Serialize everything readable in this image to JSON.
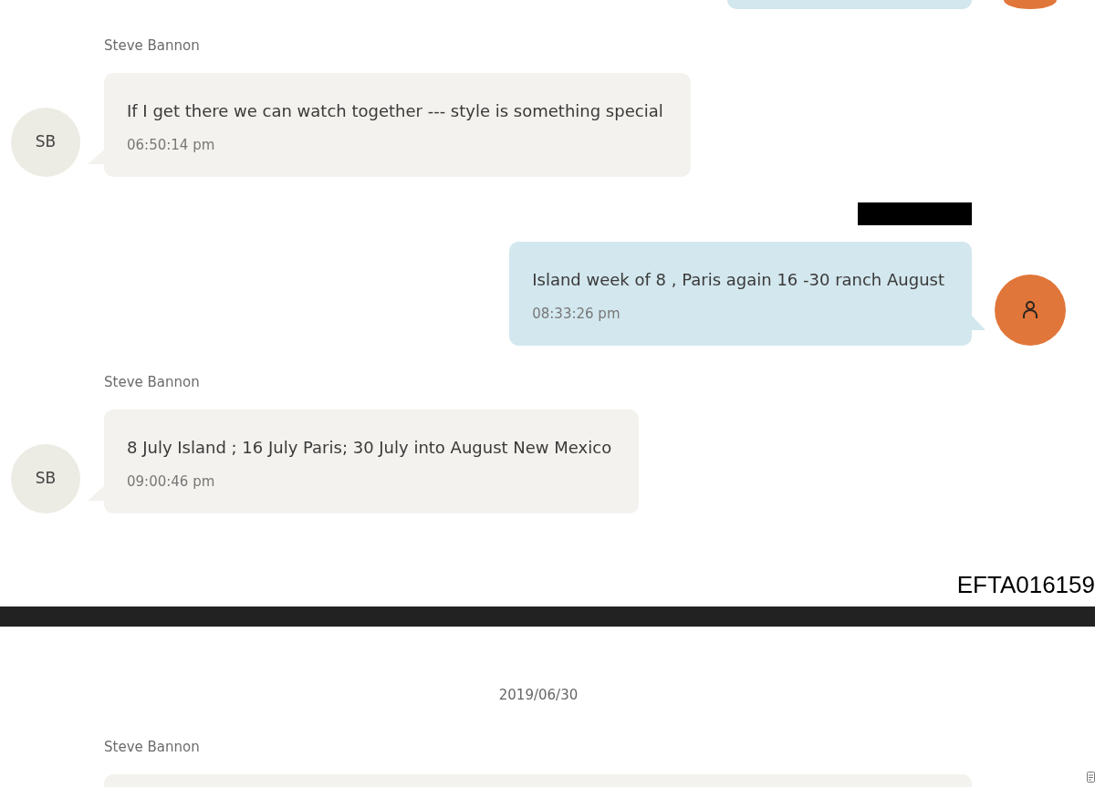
{
  "page_1": {
    "messages": [
      {
        "kind": "outgoing"
      },
      {
        "kind": "incoming",
        "sender": "Steve Bannon",
        "initials": "SB",
        "text": "If I get there we can watch together --- style is something special",
        "time": "06:50:14 pm"
      },
      {
        "kind": "outgoing",
        "sender_redacted": true,
        "text": "Island week of 8 , Paris again 16 -30 ranch August",
        "time": "08:33:26 pm"
      },
      {
        "kind": "incoming",
        "sender": "Steve Bannon",
        "initials": "SB",
        "text": "8 July Island ; 16 July Paris; 30 July into August New Mexico",
        "time": "09:00:46 pm"
      }
    ]
  },
  "document_id": "EFTA016159",
  "page_2": {
    "date": "2019/06/30",
    "messages": [
      {
        "kind": "incoming",
        "sender": "Steve Bannon"
      }
    ]
  }
}
